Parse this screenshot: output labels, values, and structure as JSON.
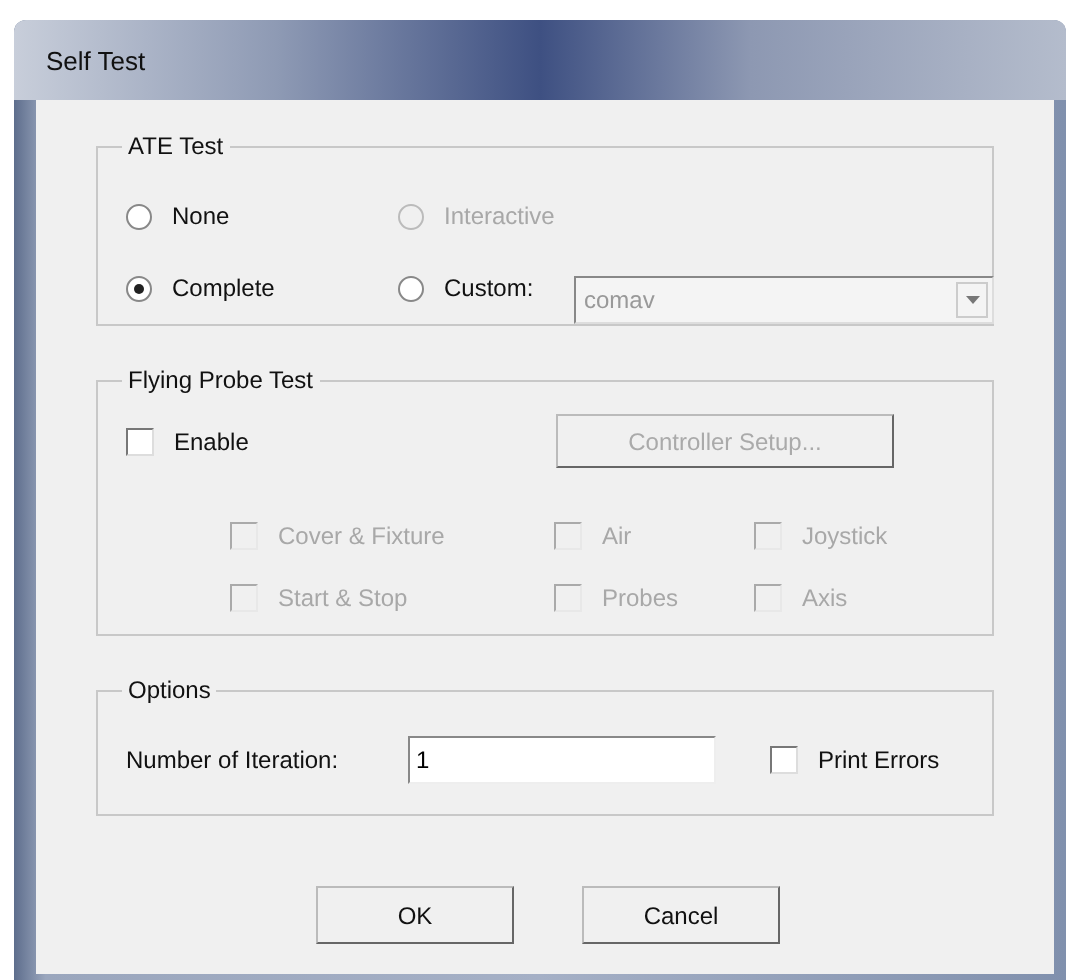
{
  "window": {
    "title": "Self Test"
  },
  "ate_test": {
    "title": "ATE Test",
    "options": [
      {
        "label": "None",
        "selected": false,
        "disabled": false
      },
      {
        "label": "Interactive",
        "selected": false,
        "disabled": true
      },
      {
        "label": "Complete",
        "selected": true,
        "disabled": false
      },
      {
        "label": "Custom:",
        "selected": false,
        "disabled": false
      }
    ],
    "custom_dropdown": {
      "value": "comav",
      "disabled": true
    }
  },
  "flying_probe_test": {
    "title": "Flying Probe Test",
    "enable": {
      "label": "Enable",
      "checked": false,
      "disabled": false
    },
    "controller_setup_button": {
      "label": "Controller Setup...",
      "disabled": true
    },
    "options": [
      {
        "label": "Cover & Fixture",
        "checked": false,
        "disabled": true
      },
      {
        "label": "Air",
        "checked": false,
        "disabled": true
      },
      {
        "label": "Joystick",
        "checked": false,
        "disabled": true
      },
      {
        "label": "Start & Stop",
        "checked": false,
        "disabled": true
      },
      {
        "label": "Probes",
        "checked": false,
        "disabled": true
      },
      {
        "label": "Axis",
        "checked": false,
        "disabled": true
      }
    ]
  },
  "options": {
    "title": "Options",
    "iteration_label": "Number of Iteration:",
    "iteration_field": {
      "value": "1"
    },
    "print_errors": {
      "label": "Print Errors",
      "checked": false,
      "disabled": false
    }
  },
  "buttons": [
    "OK",
    "Cancel"
  ]
}
